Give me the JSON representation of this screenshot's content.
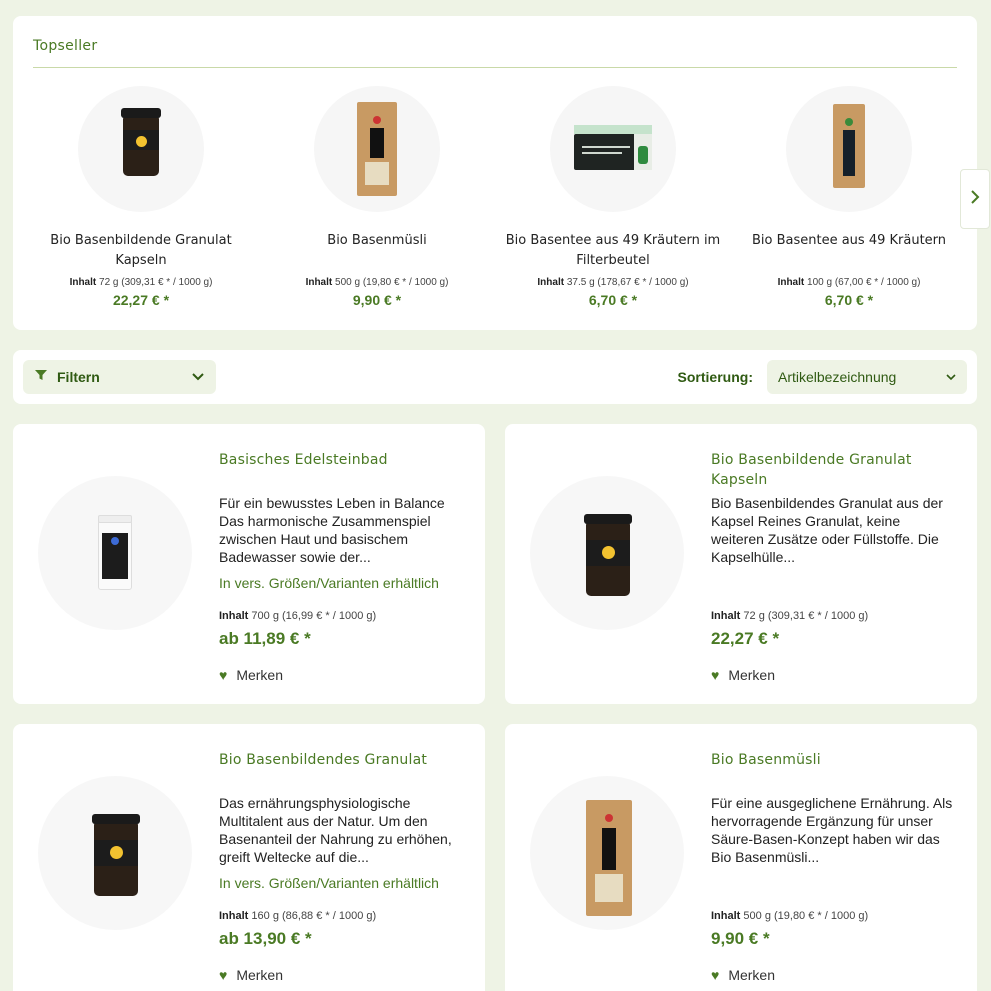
{
  "topseller": {
    "title": "Topseller",
    "items": [
      {
        "name": "Bio Basenbildende Granulat Kapseln",
        "inhalt_label": "Inhalt",
        "inhalt": "72 g (309,31 € * / 1000 g)",
        "price": "22,27 € *"
      },
      {
        "name": "Bio Basenmüsli",
        "inhalt_label": "Inhalt",
        "inhalt": "500 g (19,80 € * / 1000 g)",
        "price": "9,90 € *"
      },
      {
        "name": "Bio Basentee aus 49 Kräutern im Filterbeutel",
        "inhalt_label": "Inhalt",
        "inhalt": "37.5 g (178,67 € * / 1000 g)",
        "price": "6,70 € *"
      },
      {
        "name": "Bio Basentee aus 49 Kräutern",
        "inhalt_label": "Inhalt",
        "inhalt": "100 g (67,00 € * / 1000 g)",
        "price": "6,70 € *"
      }
    ],
    "next_icon": "chevron-right-icon"
  },
  "filterbar": {
    "filter_label": "Filtern",
    "filter_icon": "filter-icon",
    "sort_label": "Sortierung:",
    "sort_value": "Artikelbezeichnung"
  },
  "products": [
    {
      "title": "Basisches Edelsteinbad",
      "description": "Für ein bewusstes Leben in Balance Das harmonische Zusammenspiel zwischen Haut und basischem Badewasser sowie der...",
      "variant_note": "In vers. Größen/Varianten erhältlich",
      "inhalt_label": "Inhalt",
      "inhalt": "700 g (16,99 € * / 1000 g)",
      "price": "ab 11,89 € *",
      "merken": "Merken"
    },
    {
      "title": "Bio Basenbildende Granulat Kapseln",
      "description": "Bio Basenbildendes Granulat aus der Kapsel Reines Granulat, keine weiteren Zusätze oder Füllstoffe. Die Kapselhülle...",
      "variant_note": "",
      "inhalt_label": "Inhalt",
      "inhalt": "72 g (309,31 € * / 1000 g)",
      "price": "22,27 € *",
      "merken": "Merken"
    },
    {
      "title": "Bio Basenbildendes Granulat",
      "description": "Das ernährungsphysiologische Multitalent aus der Natur. Um den Basenanteil der Nahrung zu erhöhen, greift Weltecke auf die...",
      "variant_note": "In vers. Größen/Varianten erhältlich",
      "inhalt_label": "Inhalt",
      "inhalt": "160 g (86,88 € * / 1000 g)",
      "price": "ab 13,90 € *",
      "merken": "Merken"
    },
    {
      "title": "Bio Basenmüsli",
      "description": "Für eine ausgeglichene Ernährung. Als hervorragende Ergänzung für unser Säure-Basen-Konzept haben wir das Bio Basenmüsli...",
      "variant_note": "",
      "inhalt_label": "Inhalt",
      "inhalt": "500 g (19,80 € * / 1000 g)",
      "price": "9,90 € *",
      "merken": "Merken"
    }
  ]
}
